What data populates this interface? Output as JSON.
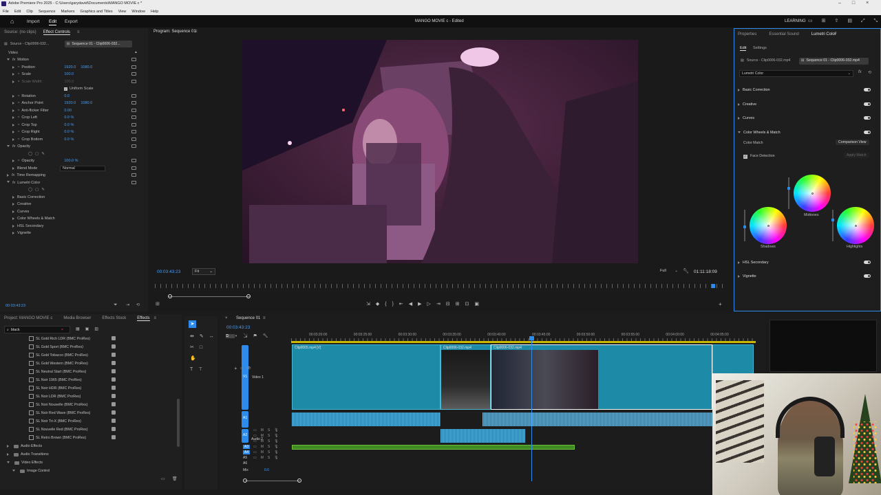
{
  "app": {
    "title": "Adobe Premiere Pro 2025 - C:\\Users\\garydavid\\Documents\\MANGO MOVIE c *",
    "menu": [
      "File",
      "Edit",
      "Clip",
      "Sequence",
      "Markers",
      "Graphics and Titles",
      "View",
      "Window",
      "Help"
    ]
  },
  "topbar": {
    "tabs": [
      "Import",
      "Edit",
      "Export"
    ],
    "active_tab": "Edit",
    "project_title": "MANGO MOVIE c - Edited",
    "workspace": "LEARNING"
  },
  "effect_controls": {
    "header_left": "Source: (no clips)",
    "header_tab": "Effect Controls",
    "source_tab": "Source - Clip0006-032...",
    "sequence_tab": "Sequence 01 - Clip0006-032...",
    "section_video": "Video",
    "rows": [
      {
        "label": "Motion",
        "level": 0,
        "fx": true,
        "open": true
      },
      {
        "label": "Position",
        "level": 1,
        "v1": "1920.0",
        "v2": "1080.0"
      },
      {
        "label": "Scale",
        "level": 1,
        "v1": "100.0"
      },
      {
        "label": "Scale Width",
        "level": 1,
        "v1": "100.0",
        "dim": true
      },
      {
        "label": "Uniform Scale",
        "level": 2,
        "check": true
      },
      {
        "label": "Rotation",
        "level": 1,
        "v1": "0.0"
      },
      {
        "label": "Anchor Point",
        "level": 1,
        "v1": "1920.0",
        "v2": "1080.0"
      },
      {
        "label": "Anti-flicker Filter",
        "level": 1,
        "v1": "0.00"
      },
      {
        "label": "Crop Left",
        "level": 1,
        "v1": "0.0 %"
      },
      {
        "label": "Crop Top",
        "level": 1,
        "v1": "0.0 %"
      },
      {
        "label": "Crop Right",
        "level": 1,
        "v1": "0.0 %"
      },
      {
        "label": "Crop Bottom",
        "level": 1,
        "v1": "0.0 %"
      },
      {
        "label": "Opacity",
        "level": 0,
        "fx": true,
        "open": true
      },
      {
        "label": "",
        "level": 1,
        "shapes": true
      },
      {
        "label": "Opacity",
        "level": 1,
        "v1": "100.0 %"
      },
      {
        "label": "Blend Mode",
        "level": 1,
        "select": "Normal"
      },
      {
        "label": "Time Remapping",
        "level": 0,
        "fx": true
      },
      {
        "label": "Lumetri Color",
        "level": 0,
        "fx": true,
        "open": true
      },
      {
        "label": "",
        "level": 1,
        "shapes": true
      },
      {
        "label": "Basic Correction",
        "level": 1
      },
      {
        "label": "Creative",
        "level": 1
      },
      {
        "label": "Curves",
        "level": 1
      },
      {
        "label": "Color Wheels & Match",
        "level": 1
      },
      {
        "label": "HSL Secondary",
        "level": 1
      },
      {
        "label": "Vignette",
        "level": 1
      }
    ],
    "timecode": "00:03:43:23"
  },
  "program": {
    "title": "Program: Sequence 01",
    "timecode": "00:03:43:23",
    "fit": "Fit",
    "quality": "Full",
    "duration": "01:11:18:09"
  },
  "lumetri": {
    "tabs": [
      "Properties",
      "Essential Sound",
      "Lumetri Color"
    ],
    "active": "Lumetri Color",
    "subtabs": [
      "Edit",
      "Settings"
    ],
    "source": "Source - Clip0006-032.mp4",
    "sequence": "Sequence 01 - Clip0006-032.mp4",
    "effect": "Lumetri Color",
    "sections": [
      "Basic Correction",
      "Creative",
      "Curves",
      "Color Wheels & Match"
    ],
    "color_match": "Color Match",
    "comparison": "Comparison View",
    "face_detection": "Face Detection",
    "apply_match": "Apply Match",
    "wheels": [
      "Midtones",
      "Shadows",
      "Highlights"
    ],
    "bottom_sections": [
      "HSL Secondary",
      "Vignette"
    ]
  },
  "project": {
    "tabs": [
      "Project: MANGO MOVIE c",
      "Media Browser",
      "Effects Stock",
      "Effects"
    ],
    "active": "Effects",
    "search": "black",
    "presets": [
      "SL Gold Rich LDR (BMC ProRes)",
      "SL Gold Sport (BMC ProRes)",
      "SL Gold Tobacco (BMC ProRes)",
      "SL Gold Western (BMC ProRes)",
      "SL Neutral Start (BMC ProRes)",
      "SL Noir 1965 (BMC ProRes)",
      "SL Noir HDR (BMC ProRes)",
      "SL Noir LDR (BMC ProRes)",
      "SL Noir Nouvelle (BMC ProRes)",
      "SL Noir Red Wave (BMC ProRes)",
      "SL Noir Tri-X (BMC ProRes)",
      "SL Nouvelle Red (BMC ProRes)",
      "SL Retro Brown (BMC ProRes)"
    ],
    "folders": [
      "Audio Effects",
      "Audio Transitions",
      "Video Effects",
      "Image Control"
    ]
  },
  "timeline": {
    "title": "Sequence 01",
    "timecode": "00:03:43:23",
    "ruler": [
      "00:03:20:00",
      "00:03:25:00",
      "00:03:30:00",
      "00:03:35:00",
      "00:03:40:00",
      "00:03:45:00",
      "00:03:50:00",
      "00:03:55:00",
      "00:04:00:00",
      "00:04:05:00"
    ],
    "clips": [
      "Clip0005.mp4 [V]",
      "Clip0006-032.mp4",
      "Clip0006-032.mp4"
    ],
    "tracks": [
      "V1",
      "Video 1",
      "A1",
      "A2",
      "Audio 2",
      "A3",
      "A4",
      "A5",
      "A6",
      "Mix"
    ],
    "mix_value": "0.0"
  },
  "colors": {
    "accent": "#2d8ceb",
    "clip": "#1d8aa8",
    "audio": "#5ab9e6",
    "green": "#3f8a22"
  }
}
